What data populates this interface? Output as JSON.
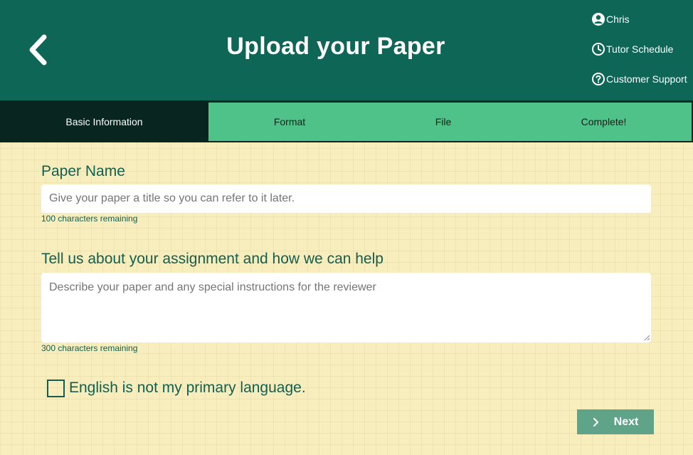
{
  "header": {
    "title": "Upload your Paper",
    "back_icon": "chevron-left-icon",
    "user_menu": [
      {
        "icon": "user-circle-icon",
        "label": "Chris"
      },
      {
        "icon": "clock-icon",
        "label": "Tutor Schedule"
      },
      {
        "icon": "question-circle-icon",
        "label": "Customer Support"
      }
    ]
  },
  "steps": [
    {
      "label": "Basic Information",
      "active": true
    },
    {
      "label": "Format",
      "active": false
    },
    {
      "label": "File",
      "active": false
    },
    {
      "label": "Complete!",
      "active": false
    }
  ],
  "form": {
    "paper_name": {
      "label": "Paper Name",
      "placeholder": "Give your paper a title so you can refer to it later.",
      "value": "",
      "hint": "100 characters remaining"
    },
    "description": {
      "label": "Tell us about your assignment and how we can help",
      "placeholder": "Describe your paper and any special instructions for the reviewer",
      "value": "",
      "hint": "300 characters remaining"
    },
    "english_checkbox": {
      "label": "English is not my primary language.",
      "checked": false
    },
    "next_button": {
      "label": "Next",
      "icon": "chevron-right-icon"
    }
  },
  "colors": {
    "header_bg": "#0e6656",
    "active_step_bg": "#08251f",
    "inactive_step_bg": "#4fc289",
    "page_bg": "#f8eebd",
    "label_text": "#145e4f",
    "next_button_bg": "#5fa388"
  }
}
